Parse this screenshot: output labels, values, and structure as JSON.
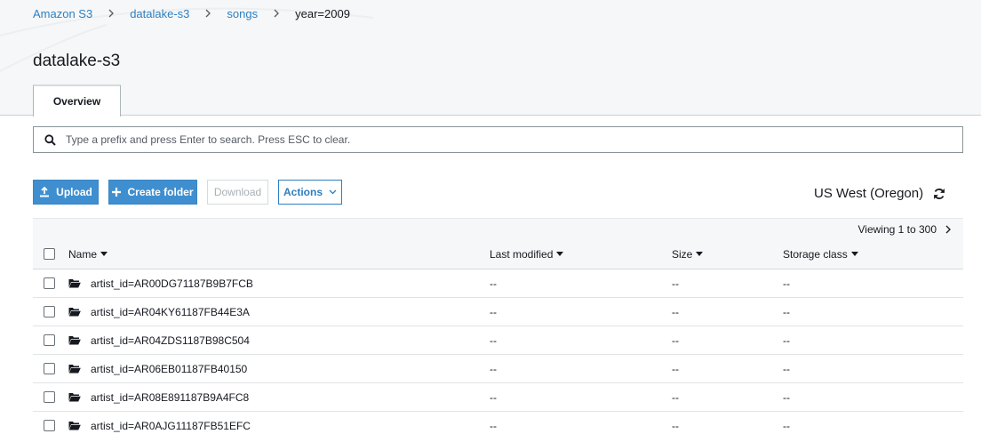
{
  "breadcrumb": [
    {
      "label": "Amazon S3",
      "link": true
    },
    {
      "label": "datalake-s3",
      "link": true
    },
    {
      "label": "songs",
      "link": true
    },
    {
      "label": "year=2009",
      "link": false
    }
  ],
  "page_title": "datalake-s3",
  "tabs": [
    {
      "label": "Overview",
      "active": true
    }
  ],
  "search": {
    "placeholder": "Type a prefix and press Enter to search. Press ESC to clear.",
    "value": ""
  },
  "toolbar": {
    "upload_label": "Upload",
    "create_folder_label": "Create folder",
    "download_label": "Download",
    "actions_label": "Actions"
  },
  "region": "US West (Oregon)",
  "pager": {
    "text": "Viewing 1 to 300"
  },
  "table": {
    "columns": [
      "Name",
      "Last modified",
      "Size",
      "Storage class"
    ],
    "rows": [
      {
        "name": "artist_id=AR00DG71187B9B7FCB",
        "last_modified": "--",
        "size": "--",
        "storage_class": "--"
      },
      {
        "name": "artist_id=AR04KY61187FB44E3A",
        "last_modified": "--",
        "size": "--",
        "storage_class": "--"
      },
      {
        "name": "artist_id=AR04ZDS1187B98C504",
        "last_modified": "--",
        "size": "--",
        "storage_class": "--"
      },
      {
        "name": "artist_id=AR06EB01187FB40150",
        "last_modified": "--",
        "size": "--",
        "storage_class": "--"
      },
      {
        "name": "artist_id=AR08E891187B9A4FC8",
        "last_modified": "--",
        "size": "--",
        "storage_class": "--"
      },
      {
        "name": "artist_id=AR0AJG11187FB51EFC",
        "last_modified": "--",
        "size": "--",
        "storage_class": "--"
      }
    ]
  },
  "colors": {
    "primary": "#3f8fd0",
    "link": "#2d7fc0",
    "band": "#f5f7f8"
  }
}
